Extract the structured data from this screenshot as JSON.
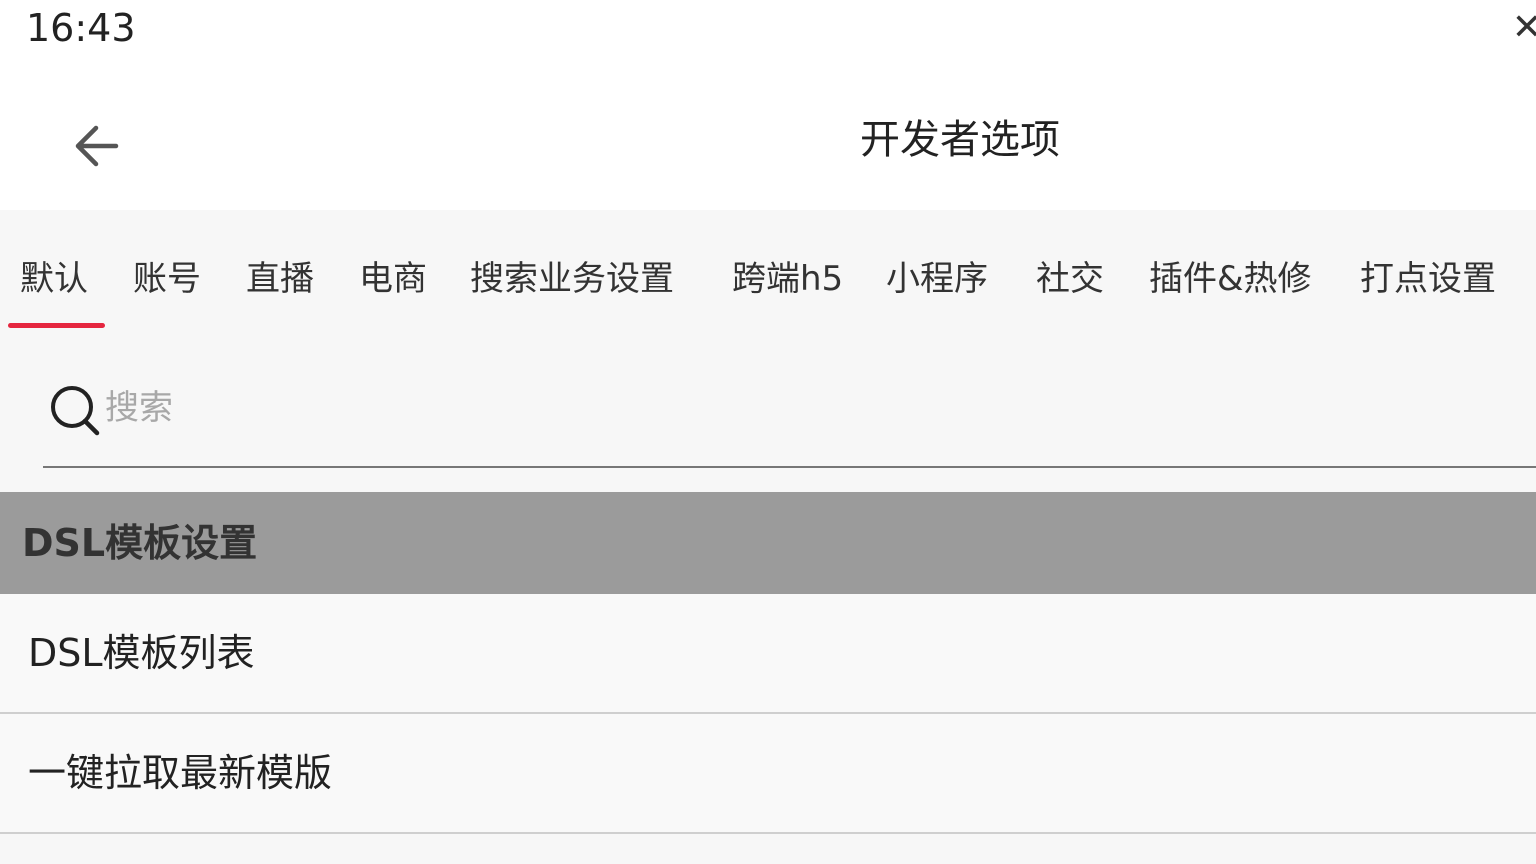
{
  "status_bar": {
    "time": "16:43",
    "right_glyph": "✕"
  },
  "header": {
    "title": "开发者选项",
    "back_icon": "arrow-left-icon"
  },
  "tabs": [
    {
      "label": "默认",
      "selected": true
    },
    {
      "label": "账号",
      "selected": false
    },
    {
      "label": "直播",
      "selected": false
    },
    {
      "label": "电商",
      "selected": false
    },
    {
      "label": "搜索业务设置",
      "selected": false
    },
    {
      "label": "跨端h5",
      "selected": false
    },
    {
      "label": "小程序",
      "selected": false
    },
    {
      "label": "社交",
      "selected": false
    },
    {
      "label": "插件&热修",
      "selected": false
    },
    {
      "label": "打点设置",
      "selected": false
    }
  ],
  "search": {
    "placeholder": "搜索",
    "value": "",
    "icon": "search-icon"
  },
  "section": {
    "title": "DSL模板设置"
  },
  "list_items": [
    {
      "label": "DSL模板列表"
    },
    {
      "label": "一键拉取最新模版"
    }
  ],
  "colors": {
    "accent": "#e5263f",
    "section_bg": "#9b9b9b",
    "page_bg": "#f7f7f7"
  }
}
